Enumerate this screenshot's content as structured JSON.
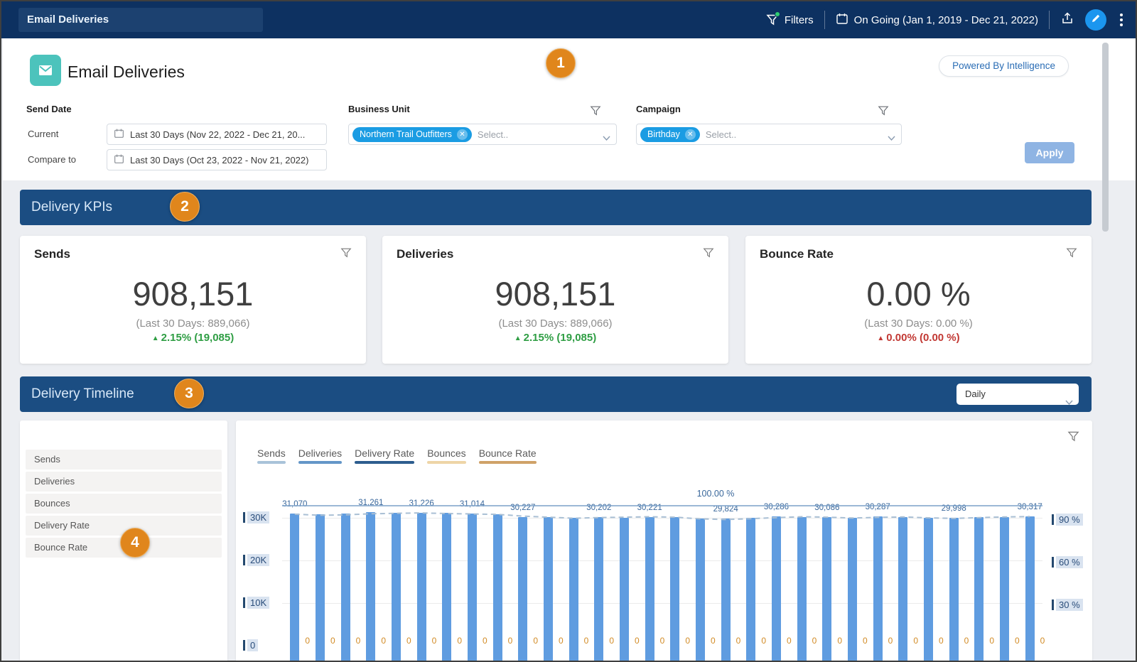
{
  "topbar": {
    "title": "Email Deliveries",
    "filters": "Filters",
    "date_range": "On Going (Jan 1, 2019 - Dec 21, 2022)"
  },
  "header": {
    "title": "Email Deliveries",
    "badge": "1",
    "powered_by": "Powered By Intelligence"
  },
  "filters": {
    "send_date": {
      "label": "Send Date",
      "current_label": "Current",
      "current_value": "Last 30 Days (Nov 22, 2022 - Dec 21, 20...",
      "compare_label": "Compare to",
      "compare_value": "Last 30 Days (Oct 23, 2022 - Nov 21, 2022)"
    },
    "business_unit": {
      "label": "Business Unit",
      "chip": "Northern Trail Outfitters",
      "placeholder": "Select.."
    },
    "campaign": {
      "label": "Campaign",
      "chip": "Birthday",
      "placeholder": "Select.."
    },
    "apply": "Apply"
  },
  "kpi_section": {
    "title": "Delivery KPIs",
    "badge": "2",
    "cards": [
      {
        "title": "Sends",
        "value": "908,151",
        "subtext": "(Last 30 Days: 889,066)",
        "delta": "2.15% (19,085)",
        "direction": "up",
        "tone": "positive"
      },
      {
        "title": "Deliveries",
        "value": "908,151",
        "subtext": "(Last 30 Days: 889,066)",
        "delta": "2.15% (19,085)",
        "direction": "up",
        "tone": "positive"
      },
      {
        "title": "Bounce Rate",
        "value": "0.00 %",
        "subtext": "(Last 30 Days: 0.00 %)",
        "delta": "0.00% (0.00 %)",
        "direction": "up",
        "tone": "negative"
      }
    ]
  },
  "timeline_section": {
    "title": "Delivery Timeline",
    "badge": "3",
    "granularity": "Daily",
    "metrics": [
      "Sends",
      "Deliveries",
      "Bounces",
      "Delivery Rate",
      "Bounce Rate"
    ],
    "metrics_badge": "4",
    "legend": [
      {
        "label": "Sends",
        "color": "#a9c3d9"
      },
      {
        "label": "Deliveries",
        "color": "#6496c8"
      },
      {
        "label": "Delivery Rate",
        "color": "#2d5d8e"
      },
      {
        "label": "Bounces",
        "color": "#eed5a7"
      },
      {
        "label": "Bounce Rate",
        "color": "#cfa268"
      }
    ]
  },
  "chart_data": {
    "type": "bar",
    "title": "Delivery Timeline — Daily",
    "bar_count": 30,
    "left_axis": {
      "ticks": [
        "30K",
        "20K",
        "10K",
        "0"
      ],
      "range": [
        0,
        30000
      ]
    },
    "right_axis": {
      "ticks": [
        "90 %",
        "60 %",
        "30 %"
      ],
      "range_percent": [
        0,
        100
      ]
    },
    "grid": true,
    "legend_position": "top",
    "series": [
      {
        "name": "Sends",
        "type": "bar",
        "color": "#5f9ce0",
        "values": [
          31070,
          30900,
          31000,
          31261,
          31150,
          31226,
          31100,
          31014,
          30900,
          30227,
          30100,
          29950,
          30202,
          30080,
          30221,
          30150,
          29900,
          29824,
          30000,
          30286,
          30150,
          30086,
          29950,
          30287,
          30100,
          29950,
          29998,
          30150,
          30200,
          30317
        ],
        "data_labels": [
          "31,070",
          null,
          null,
          "31,261",
          null,
          "31,226",
          null,
          "31,014",
          null,
          "30,227",
          null,
          null,
          "30,202",
          null,
          "30,221",
          null,
          null,
          "29,824",
          null,
          "30,286",
          null,
          "30,086",
          null,
          "30,287",
          null,
          null,
          "29,998",
          null,
          null,
          "30,317"
        ]
      },
      {
        "name": "Sends (compare: Last 30 Days)",
        "type": "line",
        "style": "dashed",
        "color": "#a9bfd4",
        "values": [
          30850,
          30600,
          30700,
          30950,
          31050,
          31150,
          31000,
          30900,
          30800,
          30400,
          30150,
          29900,
          30050,
          30150,
          30250,
          30150,
          29750,
          29600,
          29800,
          30050,
          30250,
          30150,
          29950,
          30100,
          30200,
          30000,
          29850,
          30050,
          30200,
          30300
        ]
      },
      {
        "name": "Delivery Rate",
        "type": "line",
        "axis": "right",
        "color": "#7ba1c9",
        "constant_percent": 100,
        "data_label": "100.00 %"
      },
      {
        "name": "Bounces",
        "type": "labels",
        "color": "#d28b25",
        "values": [
          0,
          0,
          0,
          0,
          0,
          0,
          0,
          0,
          0,
          0,
          0,
          0,
          0,
          0,
          0,
          0,
          0,
          0,
          0,
          0,
          0,
          0,
          0,
          0,
          0,
          0,
          0,
          0,
          0,
          0
        ]
      }
    ]
  },
  "colors": {
    "topbar_bg": "#0d3161",
    "section_bg": "#1b4d82",
    "badge": "#e0861c",
    "teal_icon": "#4cc3bc",
    "chip": "#1b9ce3",
    "apply": "#8fb4e3",
    "bar": "#5f9ce0",
    "positive": "#2f9e44",
    "negative": "#c23934"
  }
}
